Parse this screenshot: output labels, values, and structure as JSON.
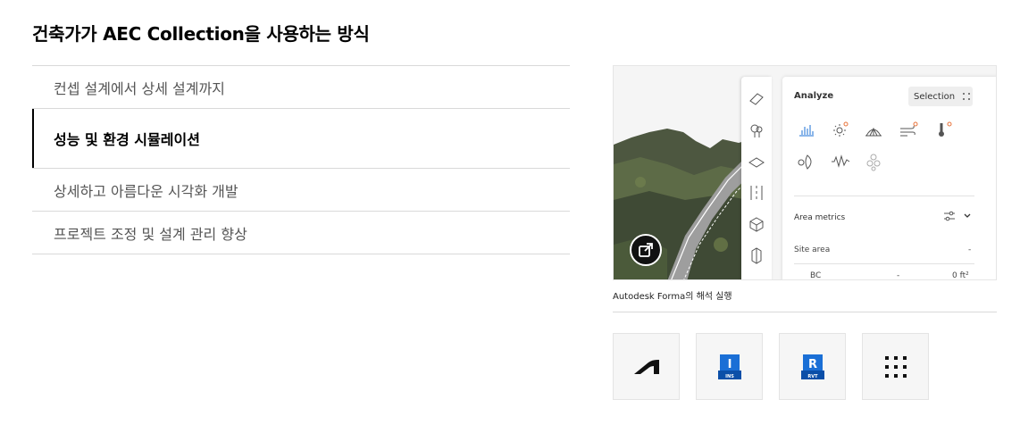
{
  "heading": "건축가가 AEC Collection을 사용하는 방식",
  "accordion": {
    "items": [
      {
        "label": "컨셉 설계에서 상세 설계까지"
      },
      {
        "label": "성능 및 환경 시뮬레이션"
      },
      {
        "label": "상세하고 아름다운 시각화 개발"
      },
      {
        "label": "프로젝트 조정 및 설계 관리 향상"
      }
    ]
  },
  "forma_panel": {
    "title": "Analyze",
    "selection_label": "Selection",
    "area_metrics_label": "Area metrics",
    "site_area_label": "Site area",
    "site_area_value": "-",
    "bc_label": "BC",
    "bc_dash": "-",
    "bc_value": "0 ft²"
  },
  "caption": "Autodesk Forma의 해석 실행",
  "products": [
    {
      "icon": "autodesk-logo-icon"
    },
    {
      "icon": "infraworks-ins-icon",
      "letter": "I",
      "sub": "INS",
      "color": "#1a6fd6"
    },
    {
      "icon": "revit-rvt-icon",
      "letter": "R",
      "sub": "RVT",
      "color": "#1a6fd6"
    },
    {
      "icon": "grid-menu-icon"
    }
  ],
  "colors": {
    "accent_blue": "#1a6fd6",
    "analysis_orange": "#e8733a"
  }
}
